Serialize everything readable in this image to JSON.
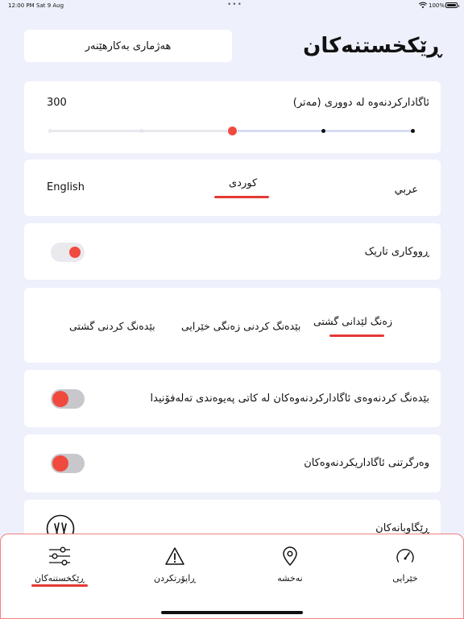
{
  "status_bar": {
    "time": "12:00 PM",
    "date": "Sat 9 Aug",
    "battery": "100%"
  },
  "header": {
    "title": "ڕێکخستنەکان",
    "stats_button": "هەژماری بەکارهێنەر"
  },
  "alert_distance": {
    "label": "ئاگادارکردنەوە لە دووری (مەتر)",
    "value": "300",
    "slider_fraction": 0.5
  },
  "language": {
    "options": [
      "عربي",
      "کوردی",
      "English"
    ],
    "selected": "کوردی"
  },
  "dark_mode": {
    "label": "ڕووکاری تاریک",
    "enabled": false
  },
  "sound": {
    "options": [
      "زەنگ لێدانی گشتی",
      "بێدەنگ کردنی زەنگی خێرایی",
      "بێدەنگ کردنی گشتی"
    ],
    "selected": "زەنگ لێدانی گشتی"
  },
  "mute_on_call": {
    "label": "بێدەنگ کردنەوەی ئاگادارکردنەوەکان لە کاتی پەیوەندی تەلەفۆنیدا",
    "enabled": false
  },
  "receive_alerts": {
    "label": "وەرگرتنی ئاگاداریکردنەوەکان",
    "enabled": false
  },
  "guides": {
    "label": "ڕێگاوبانەکان"
  },
  "bottom_nav": {
    "items": [
      {
        "label": "ڕێکخستنەکان",
        "icon": "sliders-icon",
        "active": true
      },
      {
        "label": "ڕاپۆرتکردن",
        "icon": "warning-icon",
        "active": false
      },
      {
        "label": "نەخشە",
        "icon": "map-pin-icon",
        "active": false
      },
      {
        "label": "خێرایی",
        "icon": "speedometer-icon",
        "active": false
      }
    ]
  },
  "colors": {
    "accent": "#e53935",
    "background": "#eef1fb",
    "card": "#ffffff"
  }
}
